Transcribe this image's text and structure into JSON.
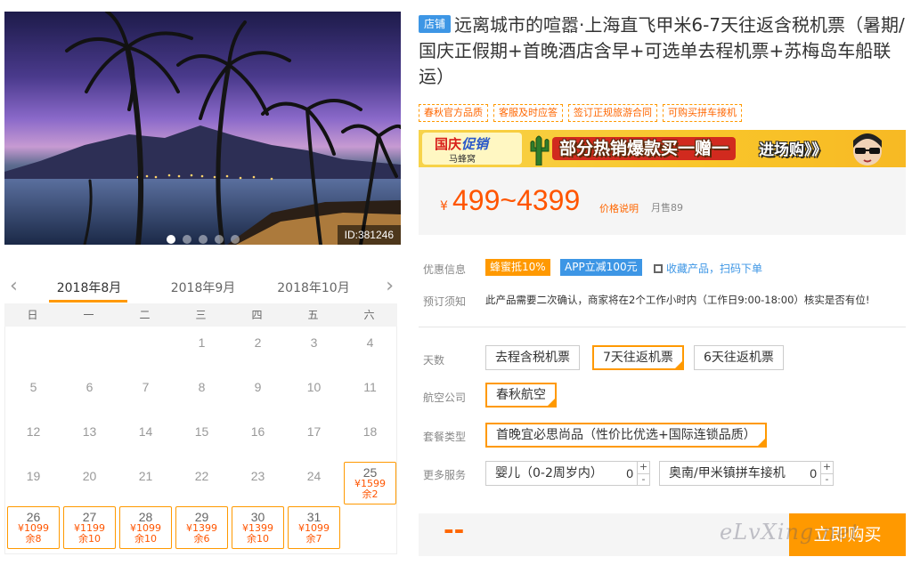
{
  "hero": {
    "id_label": "ID:381246",
    "slide_count": 5,
    "active_slide": 0
  },
  "calendar": {
    "prev_icon": "chevron-left",
    "next_icon": "chevron-right",
    "months": [
      "2018年8月",
      "2018年9月",
      "2018年10月"
    ],
    "active_month": 0,
    "weekdays": [
      "日",
      "一",
      "二",
      "三",
      "四",
      "五",
      "六"
    ],
    "days": [
      {
        "d": "1",
        "col": 3,
        "row": 0
      },
      {
        "d": "2",
        "col": 4,
        "row": 0
      },
      {
        "d": "3",
        "col": 5,
        "row": 0
      },
      {
        "d": "4",
        "col": 6,
        "row": 0
      },
      {
        "d": "5",
        "col": 0,
        "row": 1
      },
      {
        "d": "6",
        "col": 1,
        "row": 1
      },
      {
        "d": "7",
        "col": 2,
        "row": 1
      },
      {
        "d": "8",
        "col": 3,
        "row": 1
      },
      {
        "d": "9",
        "col": 4,
        "row": 1
      },
      {
        "d": "10",
        "col": 5,
        "row": 1
      },
      {
        "d": "11",
        "col": 6,
        "row": 1
      },
      {
        "d": "12",
        "col": 0,
        "row": 2
      },
      {
        "d": "13",
        "col": 1,
        "row": 2
      },
      {
        "d": "14",
        "col": 2,
        "row": 2
      },
      {
        "d": "15",
        "col": 3,
        "row": 2
      },
      {
        "d": "16",
        "col": 4,
        "row": 2
      },
      {
        "d": "17",
        "col": 5,
        "row": 2
      },
      {
        "d": "18",
        "col": 6,
        "row": 2
      },
      {
        "d": "19",
        "col": 0,
        "row": 3
      },
      {
        "d": "20",
        "col": 1,
        "row": 3
      },
      {
        "d": "21",
        "col": 2,
        "row": 3
      },
      {
        "d": "22",
        "col": 3,
        "row": 3
      },
      {
        "d": "23",
        "col": 4,
        "row": 3
      },
      {
        "d": "24",
        "col": 5,
        "row": 3
      },
      {
        "d": "25",
        "col": 6,
        "row": 3,
        "price": "¥1599",
        "left": "余2"
      },
      {
        "d": "26",
        "col": 0,
        "row": 4,
        "price": "¥1099",
        "left": "余8"
      },
      {
        "d": "27",
        "col": 1,
        "row": 4,
        "price": "¥1199",
        "left": "余10"
      },
      {
        "d": "28",
        "col": 2,
        "row": 4,
        "price": "¥1099",
        "left": "余10"
      },
      {
        "d": "29",
        "col": 3,
        "row": 4,
        "price": "¥1399",
        "left": "余6"
      },
      {
        "d": "30",
        "col": 4,
        "row": 4,
        "price": "¥1399",
        "left": "余10"
      },
      {
        "d": "31",
        "col": 5,
        "row": 4,
        "price": "¥1099",
        "left": "余7"
      }
    ]
  },
  "product": {
    "shop_badge": "店铺",
    "title": "远离城市的喧嚣·上海直飞甲米6-7天往返含税机票（暑期/国庆正假期+首晚酒店含早+可选单去程机票+苏梅岛车船联运）",
    "tags": [
      "春秋官方品质",
      "客服及时应答",
      "签订正规旅游合同",
      "可购买拼车接机"
    ]
  },
  "promo": {
    "logo_a": "国庆",
    "logo_b": "促销",
    "logo_sub": "马蜂窝",
    "headline": "部分热销爆款买一赠一",
    "enter": "进场购》》"
  },
  "price": {
    "currency": "¥",
    "range": "499~4399",
    "note": "价格说明",
    "sold": "月售89"
  },
  "offers": {
    "label": "优惠信息",
    "badge_orange": "蜂蜜抵10%",
    "badge_blue": "APP立减100元",
    "fav": "收藏产品，扫码下单",
    "fav_icon": "qr-code"
  },
  "booking": {
    "label": "预订须知",
    "notice": "此产品需要二次确认，商家将在2个工作小时内（工作日9:00-18:00）核实是否有位!"
  },
  "options": {
    "days_label": "天数",
    "days": [
      "去程含税机票",
      "7天往返机票",
      "6天往返机票"
    ],
    "days_selected": 1,
    "airline_label": "航空公司",
    "airline": "春秋航空",
    "package_label": "套餐类型",
    "package": "首晚宜必思尚品（性价比优选+国际连锁品质）",
    "more_label": "更多服务",
    "infant": "婴儿（0-2周岁内）",
    "infant_qty": "0",
    "pickup": "奥南/甲米镇拼车接机",
    "pickup_qty": "0",
    "plus": "+",
    "minus": "-"
  },
  "buy": {
    "total": "--",
    "button": "立即购买"
  },
  "watermark": "eLvXing.net",
  "colors": {
    "accent": "#ff9900",
    "price": "#ff5500",
    "blue": "#3d96e5"
  }
}
